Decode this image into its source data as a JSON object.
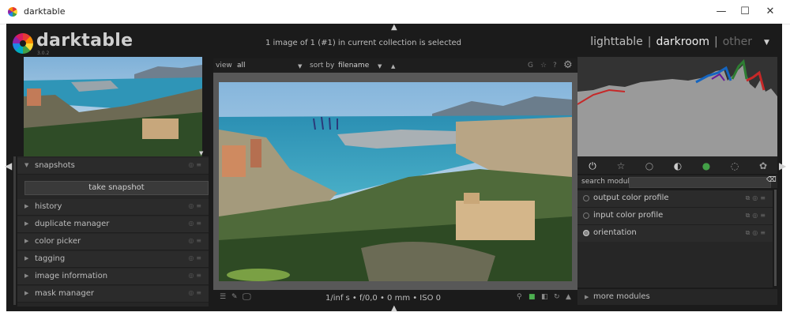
{
  "window": {
    "title": "darktable",
    "minimize": "—",
    "maximize": "☐",
    "close": "✕"
  },
  "header": {
    "brand": "darktable",
    "version": "3.0.2",
    "collection_info": "1 image of 1 (#1) in current collection is selected",
    "views": [
      {
        "label": "lighttable",
        "state": "normal"
      },
      {
        "label": "darkroom",
        "state": "active"
      },
      {
        "label": "other",
        "state": "dim"
      }
    ],
    "separator": "|",
    "menu_glyph": "▼"
  },
  "left_panel": {
    "snapshots": {
      "label": "snapshots",
      "take_snapshot": "take snapshot"
    },
    "modules": [
      {
        "label": "history"
      },
      {
        "label": "duplicate manager"
      },
      {
        "label": "color picker"
      },
      {
        "label": "tagging"
      },
      {
        "label": "image information"
      },
      {
        "label": "mask manager"
      }
    ]
  },
  "center_toolbar": {
    "view_label": "view",
    "view_value": "all",
    "sort_label": "sort by",
    "sort_value": "filename",
    "sort_dir": "▲",
    "icons": [
      "G",
      "☆",
      "?",
      "⚙"
    ]
  },
  "footer": {
    "exif": "1/inf s • f/0,0 • 0 mm • ISO 0"
  },
  "right_panel": {
    "search_label": "search module",
    "modules": [
      {
        "label": "output color profile"
      },
      {
        "label": "input color profile"
      },
      {
        "label": "orientation"
      }
    ],
    "more_modules": "more modules"
  },
  "colors": {
    "background": "#1b1b1b",
    "panel": "#2b2b2b",
    "text": "#bdbdbd",
    "highlight": "#eeeeee"
  }
}
